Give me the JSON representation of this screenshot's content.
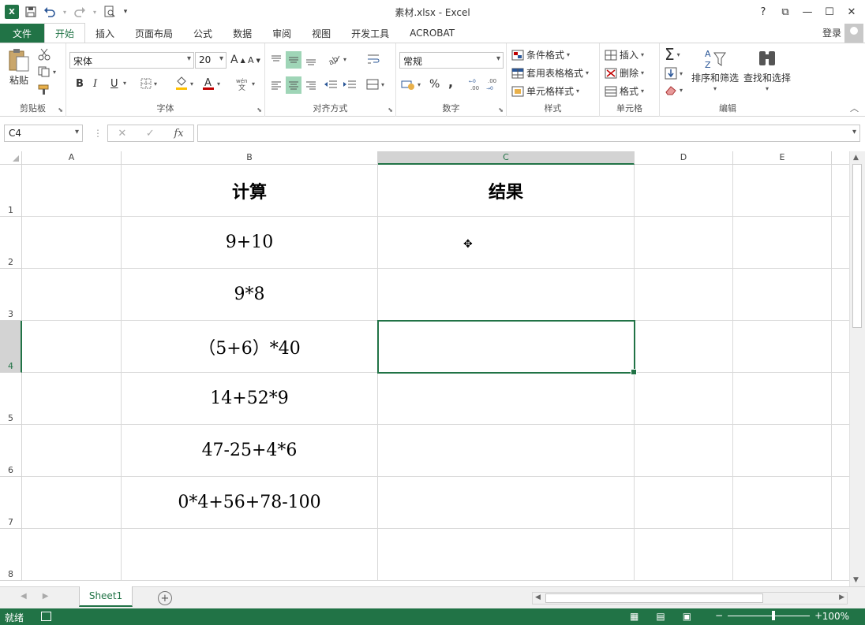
{
  "window": {
    "title": "素材.xlsx - Excel",
    "app_logo": "X",
    "controls": [
      "?",
      "⧉",
      "—",
      "☐",
      "✕"
    ]
  },
  "ribbon_tabs": [
    "文件",
    "开始",
    "插入",
    "页面布局",
    "公式",
    "数据",
    "审阅",
    "视图",
    "开发工具",
    "ACROBAT"
  ],
  "active_tab": "开始",
  "signin": "登录",
  "ribbon": {
    "clipboard": {
      "label": "剪贴板",
      "paste": "粘贴"
    },
    "font": {
      "label": "字体",
      "font_name": "宋体",
      "font_size": "20",
      "bold": "B",
      "italic": "I",
      "underline": "U",
      "grow": "A",
      "shrink": "A"
    },
    "alignment": {
      "label": "对齐方式"
    },
    "number": {
      "label": "数字",
      "format": "常规",
      "percent": "%",
      "comma": ","
    },
    "styles": {
      "label": "样式",
      "conditional": "条件格式",
      "table": "套用表格格式",
      "cell_styles": "单元格样式"
    },
    "cells": {
      "label": "单元格",
      "insert": "插入",
      "delete": "删除",
      "format": "格式"
    },
    "editing": {
      "label": "编辑",
      "sort": "排序和筛选",
      "find": "查找和选择",
      "sum": "Σ"
    }
  },
  "formula_bar": {
    "name_box": "C4",
    "cancel": "✕",
    "enter": "✓",
    "fx": "fx",
    "value": ""
  },
  "columns": [
    "A",
    "B",
    "C",
    "D",
    "E"
  ],
  "selected_col": "C",
  "rows": [
    "1",
    "2",
    "3",
    "4",
    "5",
    "6",
    "7",
    "8"
  ],
  "selected_row": "4",
  "cells": {
    "B1": "计算",
    "C1": "结果",
    "B2": "9+10",
    "B3": "9*8",
    "B4": "（5+6）*40",
    "B5": "14+52*9",
    "B6": "47-25+4*6",
    "B7": "0*4+56+78-100"
  },
  "sheets": [
    "Sheet1"
  ],
  "active_sheet": "Sheet1",
  "status": {
    "ready": "就绪",
    "zoom": "100%",
    "zoom_minus": "−",
    "zoom_plus": "+"
  },
  "colors": {
    "accent": "#217346",
    "selected_header_bg": "#d3d3d3"
  }
}
